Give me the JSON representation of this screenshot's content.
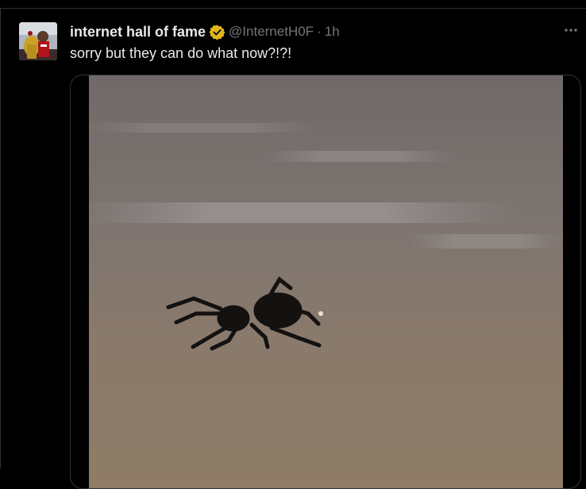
{
  "tweet": {
    "display_name": "internet hall of fame",
    "handle": "@InternetH0F",
    "separator": "·",
    "time": "1h",
    "text": "sorry but they can do what now?!?!",
    "more_icon": "more-horizontal-icon",
    "verified_icon": "verified-badge-icon",
    "colors": {
      "verified": "#e2b719",
      "muted": "#71767b",
      "primary_text": "#e7e9ea",
      "background": "#000000"
    }
  }
}
